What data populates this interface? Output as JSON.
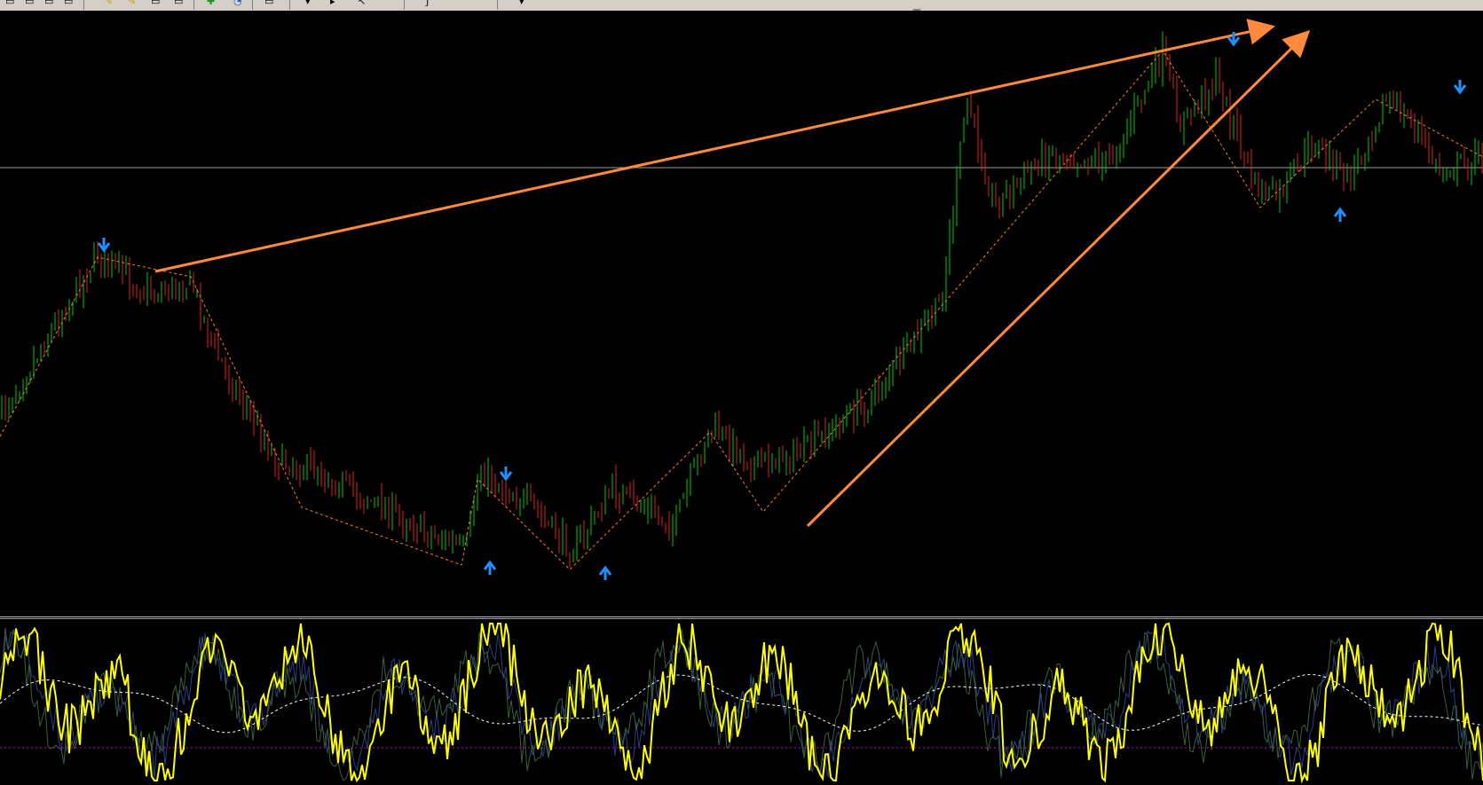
{
  "toolbar": {
    "buttons": [
      {
        "name": "new-chart-button",
        "icon": "window-icon",
        "glyph": "▭"
      },
      {
        "name": "open-button",
        "icon": "window-icon",
        "glyph": "▭"
      },
      {
        "name": "window-button",
        "icon": "window-icon",
        "glyph": "▭"
      },
      {
        "name": "tile-button",
        "icon": "window-icon",
        "glyph": "▭"
      },
      {
        "name": "pencil-button",
        "icon": "pencil-icon",
        "glyph": "✎"
      },
      {
        "name": "pen-button",
        "icon": "pen-icon",
        "glyph": "✎"
      },
      {
        "name": "cut-button",
        "icon": "window-icon",
        "glyph": "▭"
      },
      {
        "name": "copy-button",
        "icon": "window-icon",
        "glyph": "▭"
      },
      {
        "name": "zoom-in-button",
        "icon": "plus-icon",
        "glyph": "✚"
      },
      {
        "name": "history-button",
        "icon": "clock-icon",
        "glyph": "◔"
      },
      {
        "name": "template-button",
        "icon": "window-icon",
        "glyph": "▭"
      },
      {
        "name": "arrow-down-button",
        "icon": "arrow-down-icon",
        "glyph": "▾"
      },
      {
        "name": "period-button",
        "icon": "arrow-icon",
        "glyph": "▸"
      },
      {
        "name": "cursor-button",
        "icon": "cursor-icon",
        "glyph": "↖"
      },
      {
        "name": "fibonacci-button",
        "icon": "fibonacci-icon",
        "glyph": "ƒ"
      },
      {
        "name": "tools-dropdown-button",
        "icon": "chevron-down-icon",
        "glyph": "▾"
      }
    ]
  },
  "colors": {
    "background": "#000000",
    "bull_candle": "#00c800",
    "bear_candle": "#e02020",
    "zigzag": "#ff7f27",
    "trendline": "#ff8a3d",
    "signal_arrow": "#1e90ff",
    "horizontal_line": "#a0a0a0",
    "oscillator_main": "#ffff00",
    "oscillator_signal": "#ffffff",
    "oscillator_level": "#cc00cc",
    "oscillator_shadow": "#2a3a7a"
  },
  "chart_data": {
    "type": "candlestick",
    "candles_shown": "approx. 400",
    "trend": [
      "uptrend",
      "downtrend",
      "sideways",
      "uptrend",
      "correction"
    ],
    "signals": [
      {
        "type": "sell",
        "icon": "arrow-down-icon",
        "index": 0
      },
      {
        "type": "buy",
        "icon": "arrow-up-icon",
        "index": 1
      },
      {
        "type": "sell",
        "icon": "arrow-down-icon",
        "index": 2
      },
      {
        "type": "buy",
        "icon": "arrow-up-icon",
        "index": 3
      },
      {
        "type": "sell",
        "icon": "arrow-down-icon",
        "index": 4
      },
      {
        "type": "buy",
        "icon": "arrow-up-icon",
        "index": 5
      },
      {
        "type": "sell",
        "icon": "arrow-down-icon",
        "index": 6
      }
    ],
    "trendlines": [
      {
        "name": "upper-trendline"
      },
      {
        "name": "rising-trendline"
      }
    ],
    "horizontal_level": "present",
    "oscillator": {
      "levels": [
        "overbought",
        "oversold"
      ],
      "series": [
        "main",
        "signal",
        "smoothed"
      ]
    }
  }
}
